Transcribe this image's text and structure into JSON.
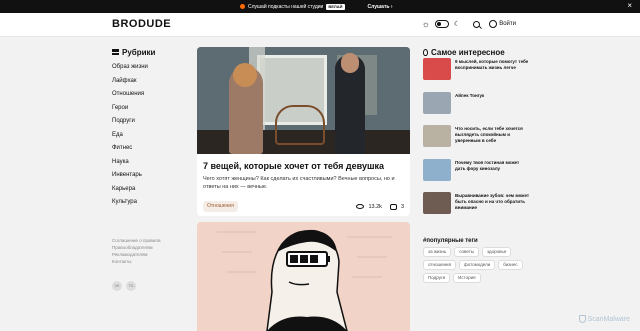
{
  "promo": {
    "text": "Слушай подкасты нашей студии",
    "brand": "ВЕЛАЙ",
    "listen": "Слушать",
    "listen_arrow": "›",
    "close": "×"
  },
  "header": {
    "logo": "BRODUDE",
    "login": "Войти",
    "icons": [
      "sun-icon",
      "theme-toggle",
      "moon-icon",
      "search-icon",
      "user-icon"
    ]
  },
  "sidebar": {
    "title": "Рубрики",
    "items": [
      "Образ жизни",
      "Лайфхак",
      "Отношения",
      "Герои",
      "Подруги",
      "Еда",
      "Фитнес",
      "Наука",
      "Инвентарь",
      "Карьера",
      "Культура"
    ],
    "footer_links": [
      "Соглашение о правила",
      "Правообладателям",
      "Рекламодателям",
      "Контакты"
    ],
    "socials": [
      "VK",
      "TG"
    ]
  },
  "main": {
    "card1": {
      "title": "7 вещей, которые хочет от тебя девушка",
      "excerpt": "Чего хотят женщины? Как сделать их счастливыми? Вечные вопросы, но и ответы на них — вечные.",
      "tag": "Отношения",
      "views": "13.2k",
      "comments": "3"
    }
  },
  "right": {
    "title": "Самое интересное",
    "items": [
      {
        "text": "9 мыслей, которые помогут тебе воспринимать жизнь легче",
        "color": "#d94a4a"
      },
      {
        "text": "Айпек Тонгук",
        "color": "#9aa7b3"
      },
      {
        "text": "Что носить, если тебе хочется выглядеть спокойным и уверенным в себе",
        "color": "#b9b1a2"
      },
      {
        "text": "Почему твоя гостиная может дать фору кинозалу",
        "color": "#8fb0cd"
      },
      {
        "text": "Выравнивание зубов: чем может быть опасно и на что обратить внимание",
        "color": "#6e5b52"
      }
    ],
    "tags_title": "#популярные теги",
    "tags": [
      "за жизнь",
      "советы",
      "здоровье",
      "отношения",
      "фотомодели",
      "бизнес",
      "Подруги",
      "История"
    ]
  },
  "watermark": "ScanMalware"
}
